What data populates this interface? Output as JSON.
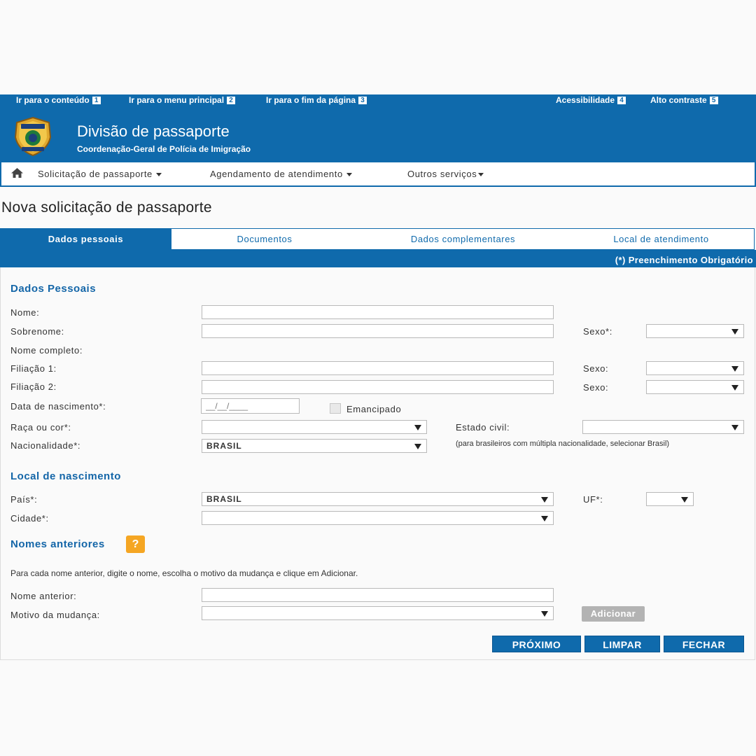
{
  "skip_links": [
    {
      "label": "Ir para o conteúdo",
      "key": "1"
    },
    {
      "label": "Ir para o menu principal",
      "key": "2"
    },
    {
      "label": "Ir para o fim da página",
      "key": "3"
    }
  ],
  "access_links": [
    {
      "label": "Acessibilidade",
      "key": "4"
    },
    {
      "label": "Alto contraste",
      "key": "5"
    }
  ],
  "header": {
    "title": "Divisão de passaporte",
    "subtitle": "Coordenação-Geral de Polícia de Imigração"
  },
  "nav": {
    "home_icon": "home-icon",
    "items": [
      "Solicitação de passaporte",
      "Agendamento de atendimento",
      "Outros serviços"
    ]
  },
  "page_title": "Nova solicitação de passaporte",
  "tabs": [
    {
      "label": "Dados pessoais",
      "active": true
    },
    {
      "label": "Documentos",
      "active": false
    },
    {
      "label": "Dados complementares",
      "active": false
    },
    {
      "label": "Local de atendimento",
      "active": false
    }
  ],
  "required_note": "(*) Preenchimento Obrigatório",
  "dados_pessoais": {
    "heading": "Dados Pessoais",
    "nome_label": "Nome:",
    "sobrenome_label": "Sobrenome:",
    "sexo_req_label": "Sexo*:",
    "nome_completo_label": "Nome completo:",
    "filiacao1_label": "Filiação 1:",
    "filiacao2_label": "Filiação 2:",
    "sexo_label": "Sexo:",
    "nascimento_label": "Data de nascimento*:",
    "nascimento_placeholder": "__/__/____",
    "emancipado_label": "Emancipado",
    "raca_label": "Raça ou cor*:",
    "estado_civil_label": "Estado civil:",
    "nacionalidade_label": "Nacionalidade*:",
    "nacionalidade_value": "BRASIL",
    "nacionalidade_hint": "(para brasileiros com múltipla nacionalidade, selecionar Brasil)"
  },
  "local_nascimento": {
    "heading": "Local de nascimento",
    "pais_label": "País*:",
    "pais_value": "BRASIL",
    "uf_label": "UF*:",
    "cidade_label": "Cidade*:"
  },
  "nomes_anteriores": {
    "heading": "Nomes anteriores",
    "help_icon": "?",
    "instruction": "Para cada nome anterior, digite o nome, escolha o motivo da mudança e clique em Adicionar.",
    "nome_anterior_label": "Nome anterior:",
    "motivo_label": "Motivo da mudança:",
    "add_label": "Adicionar"
  },
  "buttons": {
    "next": "PRÓXIMO",
    "clear": "LIMPAR",
    "close": "FECHAR"
  },
  "colors": {
    "brand": "#0f6aac",
    "section": "#1466a8",
    "help": "#f5a623"
  }
}
